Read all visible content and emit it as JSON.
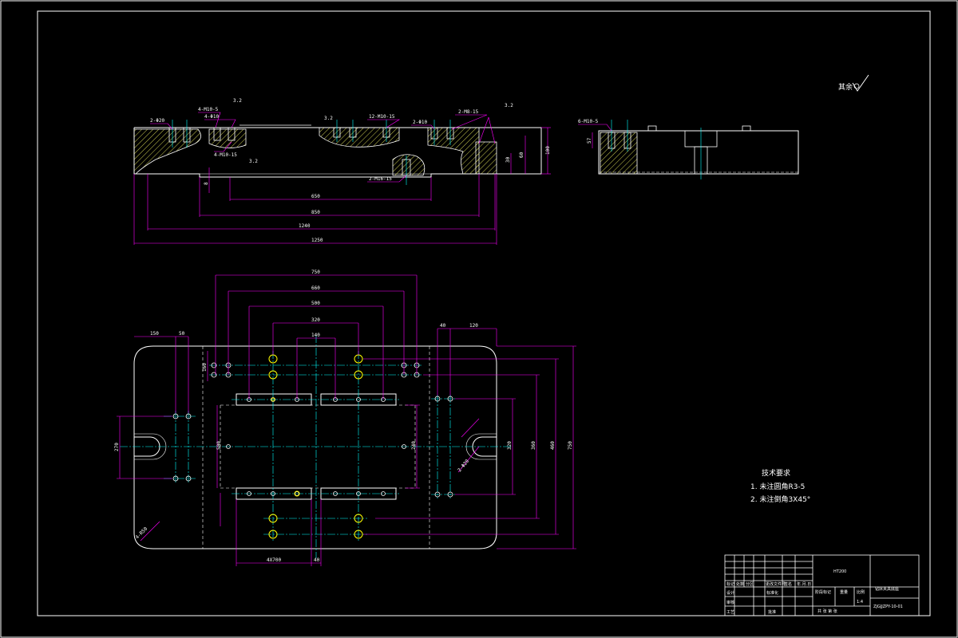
{
  "colors": {
    "background": "#000000",
    "outline": "#ffffff",
    "dimension": "#ff00ff",
    "centerline": "#00ffff",
    "hole": "#ffff00",
    "hatch": "#ffff66"
  },
  "roughness_label": "其余",
  "front_view": {
    "horizontal_dims": [
      "650",
      "850",
      "1240",
      "1250"
    ],
    "vertical_dims": [
      "100",
      "60",
      "30",
      "8"
    ],
    "callouts": [
      "2-Φ20",
      "4-Φ10",
      "4-M10-5",
      "4-M10-15",
      "12-M10-15",
      "2-Φ10",
      "2-M8-15",
      "2-M16-15",
      "3.2",
      "3.2",
      "3.2",
      "3.2"
    ]
  },
  "side_view": {
    "callouts": [
      "6-M10-5",
      "57"
    ]
  },
  "top_view": {
    "top_dims": [
      "750",
      "660",
      "500",
      "320",
      "140",
      "150",
      "50",
      "40",
      "120"
    ],
    "right_dims": [
      "240",
      "320",
      "360",
      "460",
      "750"
    ],
    "left_dims": [
      "270",
      "160",
      "500"
    ],
    "bottom_dims": [
      "4X700",
      "40"
    ],
    "misc": [
      "4-R50",
      "2-Φ20"
    ]
  },
  "tech_requirements": {
    "title": "技术要求",
    "items": [
      "1. 未注圆角R3-5",
      "2. 未注倒角3X45°"
    ]
  },
  "title_block": {
    "material": "HT200",
    "part_name": "钻床夹具底座",
    "drawing_no": "ZJGJJZPY-10-01",
    "headers": [
      "标记",
      "处数",
      "分区",
      "更改文件号",
      "签名",
      "年.月.日"
    ],
    "rows": [
      "设计",
      "审核",
      "工艺"
    ],
    "std_label": "标准化",
    "approve_label": "批准",
    "stage_label": "阶段标记",
    "weight_label": "重量",
    "scale_label": "比例",
    "scale": "1:4",
    "sheet_text": "共 张 第 张"
  }
}
